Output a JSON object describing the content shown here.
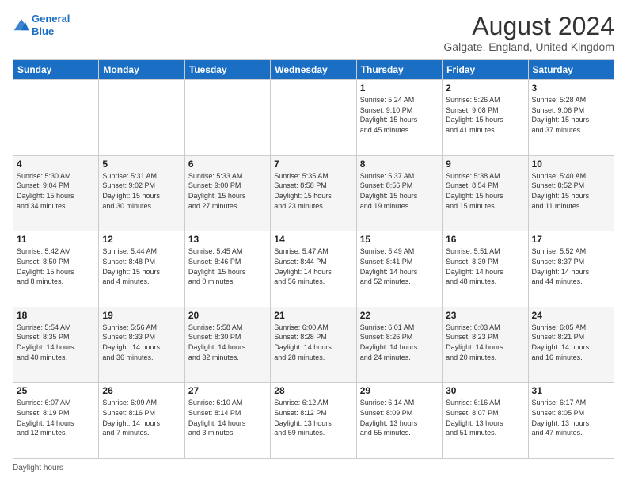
{
  "header": {
    "logo_line1": "General",
    "logo_line2": "Blue",
    "main_title": "August 2024",
    "subtitle": "Galgate, England, United Kingdom"
  },
  "footer": {
    "daylight_label": "Daylight hours"
  },
  "weekdays": [
    "Sunday",
    "Monday",
    "Tuesday",
    "Wednesday",
    "Thursday",
    "Friday",
    "Saturday"
  ],
  "weeks": [
    [
      {
        "day": "",
        "info": ""
      },
      {
        "day": "",
        "info": ""
      },
      {
        "day": "",
        "info": ""
      },
      {
        "day": "",
        "info": ""
      },
      {
        "day": "1",
        "info": "Sunrise: 5:24 AM\nSunset: 9:10 PM\nDaylight: 15 hours\nand 45 minutes."
      },
      {
        "day": "2",
        "info": "Sunrise: 5:26 AM\nSunset: 9:08 PM\nDaylight: 15 hours\nand 41 minutes."
      },
      {
        "day": "3",
        "info": "Sunrise: 5:28 AM\nSunset: 9:06 PM\nDaylight: 15 hours\nand 37 minutes."
      }
    ],
    [
      {
        "day": "4",
        "info": "Sunrise: 5:30 AM\nSunset: 9:04 PM\nDaylight: 15 hours\nand 34 minutes."
      },
      {
        "day": "5",
        "info": "Sunrise: 5:31 AM\nSunset: 9:02 PM\nDaylight: 15 hours\nand 30 minutes."
      },
      {
        "day": "6",
        "info": "Sunrise: 5:33 AM\nSunset: 9:00 PM\nDaylight: 15 hours\nand 27 minutes."
      },
      {
        "day": "7",
        "info": "Sunrise: 5:35 AM\nSunset: 8:58 PM\nDaylight: 15 hours\nand 23 minutes."
      },
      {
        "day": "8",
        "info": "Sunrise: 5:37 AM\nSunset: 8:56 PM\nDaylight: 15 hours\nand 19 minutes."
      },
      {
        "day": "9",
        "info": "Sunrise: 5:38 AM\nSunset: 8:54 PM\nDaylight: 15 hours\nand 15 minutes."
      },
      {
        "day": "10",
        "info": "Sunrise: 5:40 AM\nSunset: 8:52 PM\nDaylight: 15 hours\nand 11 minutes."
      }
    ],
    [
      {
        "day": "11",
        "info": "Sunrise: 5:42 AM\nSunset: 8:50 PM\nDaylight: 15 hours\nand 8 minutes."
      },
      {
        "day": "12",
        "info": "Sunrise: 5:44 AM\nSunset: 8:48 PM\nDaylight: 15 hours\nand 4 minutes."
      },
      {
        "day": "13",
        "info": "Sunrise: 5:45 AM\nSunset: 8:46 PM\nDaylight: 15 hours\nand 0 minutes."
      },
      {
        "day": "14",
        "info": "Sunrise: 5:47 AM\nSunset: 8:44 PM\nDaylight: 14 hours\nand 56 minutes."
      },
      {
        "day": "15",
        "info": "Sunrise: 5:49 AM\nSunset: 8:41 PM\nDaylight: 14 hours\nand 52 minutes."
      },
      {
        "day": "16",
        "info": "Sunrise: 5:51 AM\nSunset: 8:39 PM\nDaylight: 14 hours\nand 48 minutes."
      },
      {
        "day": "17",
        "info": "Sunrise: 5:52 AM\nSunset: 8:37 PM\nDaylight: 14 hours\nand 44 minutes."
      }
    ],
    [
      {
        "day": "18",
        "info": "Sunrise: 5:54 AM\nSunset: 8:35 PM\nDaylight: 14 hours\nand 40 minutes."
      },
      {
        "day": "19",
        "info": "Sunrise: 5:56 AM\nSunset: 8:33 PM\nDaylight: 14 hours\nand 36 minutes."
      },
      {
        "day": "20",
        "info": "Sunrise: 5:58 AM\nSunset: 8:30 PM\nDaylight: 14 hours\nand 32 minutes."
      },
      {
        "day": "21",
        "info": "Sunrise: 6:00 AM\nSunset: 8:28 PM\nDaylight: 14 hours\nand 28 minutes."
      },
      {
        "day": "22",
        "info": "Sunrise: 6:01 AM\nSunset: 8:26 PM\nDaylight: 14 hours\nand 24 minutes."
      },
      {
        "day": "23",
        "info": "Sunrise: 6:03 AM\nSunset: 8:23 PM\nDaylight: 14 hours\nand 20 minutes."
      },
      {
        "day": "24",
        "info": "Sunrise: 6:05 AM\nSunset: 8:21 PM\nDaylight: 14 hours\nand 16 minutes."
      }
    ],
    [
      {
        "day": "25",
        "info": "Sunrise: 6:07 AM\nSunset: 8:19 PM\nDaylight: 14 hours\nand 12 minutes."
      },
      {
        "day": "26",
        "info": "Sunrise: 6:09 AM\nSunset: 8:16 PM\nDaylight: 14 hours\nand 7 minutes."
      },
      {
        "day": "27",
        "info": "Sunrise: 6:10 AM\nSunset: 8:14 PM\nDaylight: 14 hours\nand 3 minutes."
      },
      {
        "day": "28",
        "info": "Sunrise: 6:12 AM\nSunset: 8:12 PM\nDaylight: 13 hours\nand 59 minutes."
      },
      {
        "day": "29",
        "info": "Sunrise: 6:14 AM\nSunset: 8:09 PM\nDaylight: 13 hours\nand 55 minutes."
      },
      {
        "day": "30",
        "info": "Sunrise: 6:16 AM\nSunset: 8:07 PM\nDaylight: 13 hours\nand 51 minutes."
      },
      {
        "day": "31",
        "info": "Sunrise: 6:17 AM\nSunset: 8:05 PM\nDaylight: 13 hours\nand 47 minutes."
      }
    ]
  ]
}
